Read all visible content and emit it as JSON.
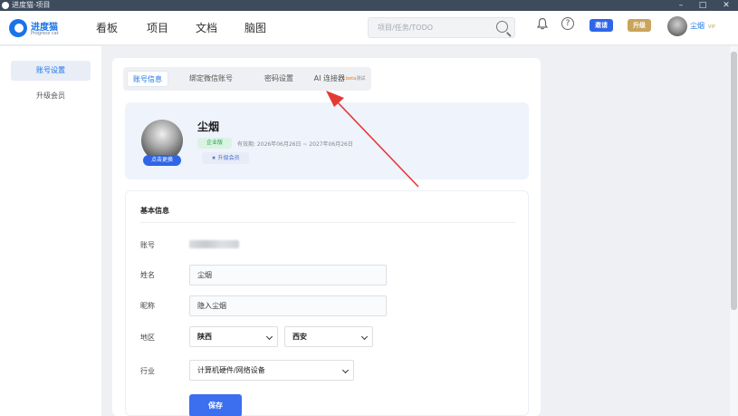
{
  "window": {
    "title": "进度猫·项目",
    "controls": {
      "minimize": "–",
      "maximize": "□",
      "close": "✕"
    }
  },
  "brand": {
    "name": "进度猫",
    "subtitle": "Progress cat"
  },
  "nav": {
    "items": [
      "看板",
      "项目",
      "文档",
      "脑图"
    ]
  },
  "search": {
    "placeholder": "项目/任务/TODO"
  },
  "header": {
    "invite_label": "邀请",
    "upgrade_label": "升级",
    "user_name": "尘烟",
    "vip_label": "VIP"
  },
  "sidebar": {
    "items": [
      {
        "label": "账号设置",
        "active": true
      },
      {
        "label": "升级会员",
        "active": false
      }
    ]
  },
  "tabs": [
    {
      "label": "账号信息",
      "active": true
    },
    {
      "label": "绑定微信账号",
      "active": false
    },
    {
      "label": "密码设置",
      "active": false
    },
    {
      "label": "AI 连接器",
      "beta": "beta",
      "test": "测试",
      "active": false
    }
  ],
  "profile": {
    "name": "尘烟",
    "change_avatar": "点击更换",
    "edition": "企业版",
    "validity": "有效期: 2026年06月26日 ~ 2027年06月26日",
    "upgrade": "★ 升级会员"
  },
  "basic_info": {
    "title": "基本信息",
    "account_label": "账号",
    "name_label": "姓名",
    "name_value": "尘烟",
    "nickname_label": "昵称",
    "nickname_value": "隐入尘烟",
    "region_label": "地区",
    "province": "陕西",
    "city": "西安",
    "industry_label": "行业",
    "industry": "计算机硬件/网络设备",
    "save": "保存"
  },
  "colors": {
    "accent": "#1a73e8",
    "invite": "#2f66e8",
    "upgrade": "#c9a45b",
    "annotation": "#e53935"
  }
}
